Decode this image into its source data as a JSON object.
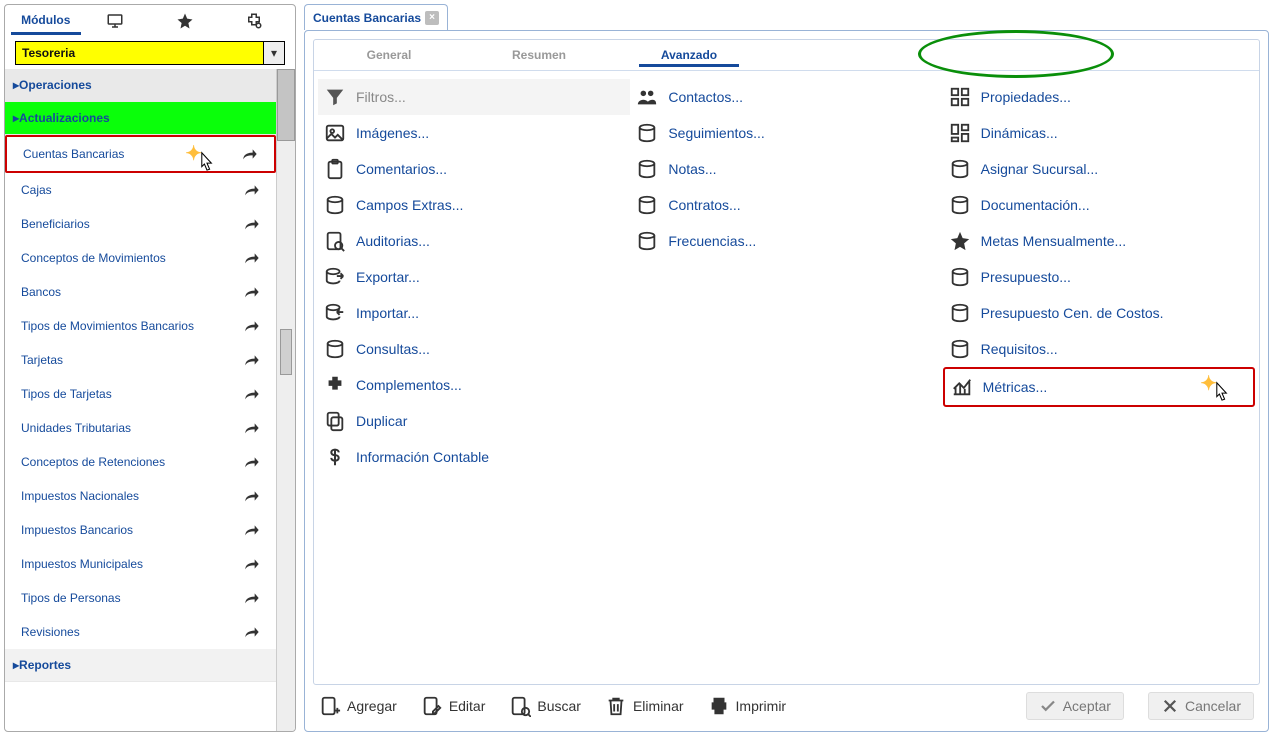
{
  "sidebar": {
    "tab_label": "Módulos",
    "combo_value": "Tesoreria",
    "sections": {
      "operaciones": "Operaciones",
      "actualizaciones": "Actualizaciones",
      "reportes": "Reportes"
    },
    "items": [
      "Cuentas Bancarias",
      "Cajas",
      "Beneficiarios",
      "Conceptos de Movimientos",
      "Bancos",
      "Tipos de Movimientos Bancarios",
      "Tarjetas",
      "Tipos de Tarjetas",
      "Unidades Tributarias",
      "Conceptos de Retenciones",
      "Impuestos Nacionales",
      "Impuestos Bancarios",
      "Impuestos Municipales",
      "Tipos de Personas",
      "Revisiones"
    ]
  },
  "doc_tab": {
    "title": "Cuentas Bancarias"
  },
  "sub_tabs": {
    "general": "General",
    "resumen": "Resumen",
    "avanzado": "Avanzado"
  },
  "options": {
    "col0": [
      "Filtros...",
      "Imágenes...",
      "Comentarios...",
      "Campos Extras...",
      "Auditorias...",
      "Exportar...",
      "Importar...",
      "Consultas...",
      "Complementos...",
      "Duplicar",
      "Información Contable"
    ],
    "col1": [
      "Contactos...",
      "Seguimientos...",
      "Notas...",
      "Contratos...",
      "Frecuencias..."
    ],
    "col2": [
      "Propiedades...",
      "Dinámicas...",
      "Asignar Sucursal...",
      "Documentación...",
      "Metas Mensualmente...",
      "Presupuesto...",
      "Presupuesto Cen. de Costos.",
      "Requisitos...",
      "Métricas..."
    ]
  },
  "toolbar": {
    "agregar": "Agregar",
    "editar": "Editar",
    "buscar": "Buscar",
    "eliminar": "Eliminar",
    "imprimir": "Imprimir",
    "aceptar": "Aceptar",
    "cancelar": "Cancelar"
  }
}
